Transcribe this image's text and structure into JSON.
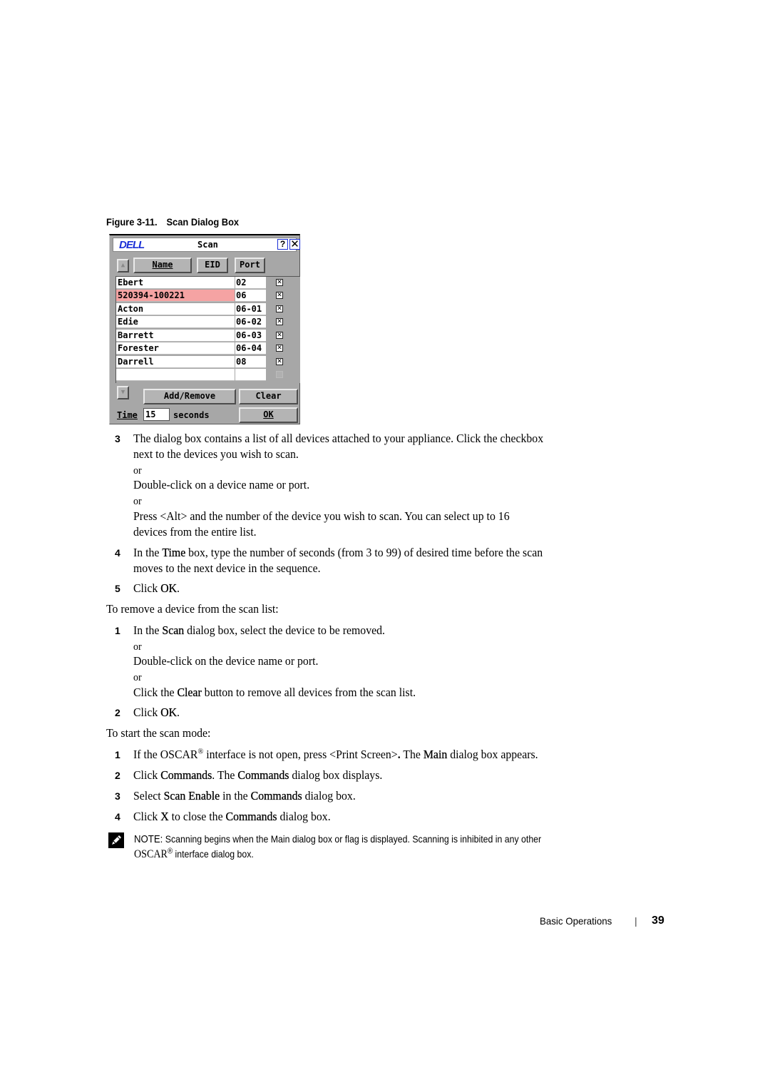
{
  "figure": {
    "number": "Figure 3-11.",
    "title": "Scan Dialog Box"
  },
  "dialog": {
    "logo": "DELL",
    "title": "Scan",
    "help_label": "?",
    "close_label": "✕",
    "columns": {
      "name": "Name",
      "eid": "EID",
      "port": "Port"
    },
    "rows": [
      {
        "name": "Ebert",
        "port": "02",
        "checked": true,
        "selected": false
      },
      {
        "name": "520394-100221",
        "port": "06",
        "checked": true,
        "selected": true
      },
      {
        "name": "Acton",
        "port": "06-01",
        "checked": true,
        "selected": false
      },
      {
        "name": "Edie",
        "port": "06-02",
        "checked": true,
        "selected": false
      },
      {
        "name": "Barrett",
        "port": "06-03",
        "checked": true,
        "selected": false
      },
      {
        "name": "Forester",
        "port": "06-04",
        "checked": true,
        "selected": false
      },
      {
        "name": "Darrell",
        "port": "08",
        "checked": true,
        "selected": false
      },
      {
        "name": "",
        "port": "",
        "checked": false,
        "selected": false
      }
    ],
    "add_remove_label": "Add/Remove",
    "clear_label": "Clear",
    "ok_label": "OK",
    "time_label": "Time",
    "time_value": "15",
    "seconds_label": "seconds",
    "scroll_up_icon": "▲",
    "scroll_down_icon": "▼"
  },
  "steps_a": [
    {
      "num": "3",
      "line1": "The dialog box contains a list of all devices attached to your appliance. Click the checkbox",
      "line2": "next to the devices you wish to scan.",
      "or1": "or",
      "alt1": "Double-click on a device name or port.",
      "or2": "or",
      "alt2a": "Press <Alt> and the number of the device you wish to scan. You can select up to 16",
      "alt2b": "devices from the entire list."
    },
    {
      "num": "4",
      "pre": "In the ",
      "kw": "Time",
      "post": " box, type the number of seconds (from 3 to 99) of desired time before the scan",
      "line2": "moves to the next device in the sequence."
    },
    {
      "num": "5",
      "pre": "Click ",
      "kw": "OK",
      "post": "."
    }
  ],
  "remove_intro": "To remove a device from the scan list:",
  "steps_b": [
    {
      "num": "1",
      "pre": "In the ",
      "kw": "Scan",
      "post": " dialog box, select the device to be removed.",
      "or1": "or",
      "alt1": "Double-click on the device name or port.",
      "or2": "or",
      "alt2_pre": "Click the ",
      "alt2_kw": "Clear",
      "alt2_post": " button to remove all devices from the scan list."
    },
    {
      "num": "2",
      "pre": "Click ",
      "kw": "OK",
      "post": "."
    }
  ],
  "start_intro": "To start the scan mode:",
  "steps_c": [
    {
      "num": "1",
      "pre": "If the OSCAR",
      "sup": "®",
      "mid": " interface is not open, press <Print Screen>",
      "bold_dot": ".",
      "mid2": " The ",
      "kw": "Main",
      "post": " dialog box appears."
    },
    {
      "num": "2",
      "pre": "Click ",
      "kw": "Commands",
      "mid": ". The ",
      "kw2": "Commands",
      "post": " dialog box displays."
    },
    {
      "num": "3",
      "pre": "Select ",
      "kw": "Scan Enable",
      "mid": " in the ",
      "kw2": "Commands",
      "post": " dialog box."
    },
    {
      "num": "4",
      "pre": "Click ",
      "kw": "X",
      "mid": " to close the ",
      "kw2": "Commands",
      "post": " dialog box."
    }
  ],
  "note": {
    "label": "NOTE:",
    "line1": "Scanning begins when the Main dialog box or flag is displayed. Scanning is inhibited in any other",
    "line2_oscar": "OSCAR",
    "line2_sup": "®",
    "line2_rest": " interface dialog box.",
    "icon": "pencil-note-icon"
  },
  "footer": {
    "section": "Basic Operations",
    "separator": "|",
    "page": "39"
  }
}
